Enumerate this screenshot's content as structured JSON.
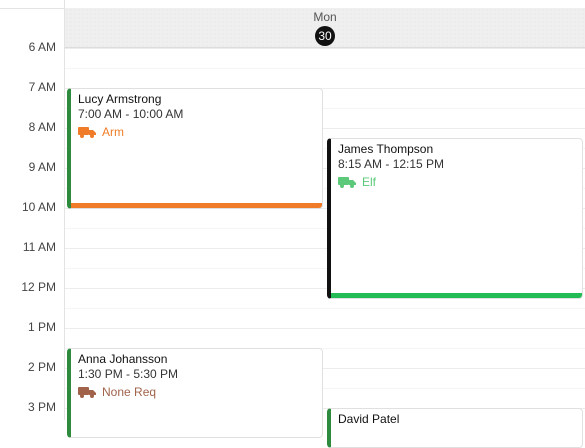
{
  "header": {
    "day_name": "Mon",
    "day_number": "30"
  },
  "time_labels": [
    "6 AM",
    "7 AM",
    "8 AM",
    "9 AM",
    "10 AM",
    "11 AM",
    "12 PM",
    "1 PM",
    "2 PM",
    "3 PM"
  ],
  "events": [
    {
      "name": "Lucy Armstrong",
      "time": "7:00 AM - 10:00 AM",
      "tag": "Arm",
      "tag_color": "#f07c2a",
      "bar_color": "#f07c2a",
      "left_color": "#2e8b3e"
    },
    {
      "name": "James Thompson",
      "time": "8:15 AM - 12:15 PM",
      "tag": "Elf",
      "tag_color": "#5cc97a",
      "bar_color": "#22bb55",
      "left_color": "#111111"
    },
    {
      "name": "Anna Johansson",
      "time": "1:30 PM - 5:30 PM",
      "tag": "None Req",
      "tag_color": "#a0634a",
      "bar_color": "",
      "left_color": "#2e8b3e"
    },
    {
      "name": "David Patel",
      "time": "",
      "tag": "",
      "tag_color": "",
      "bar_color": "",
      "left_color": "#2e8b3e"
    }
  ]
}
